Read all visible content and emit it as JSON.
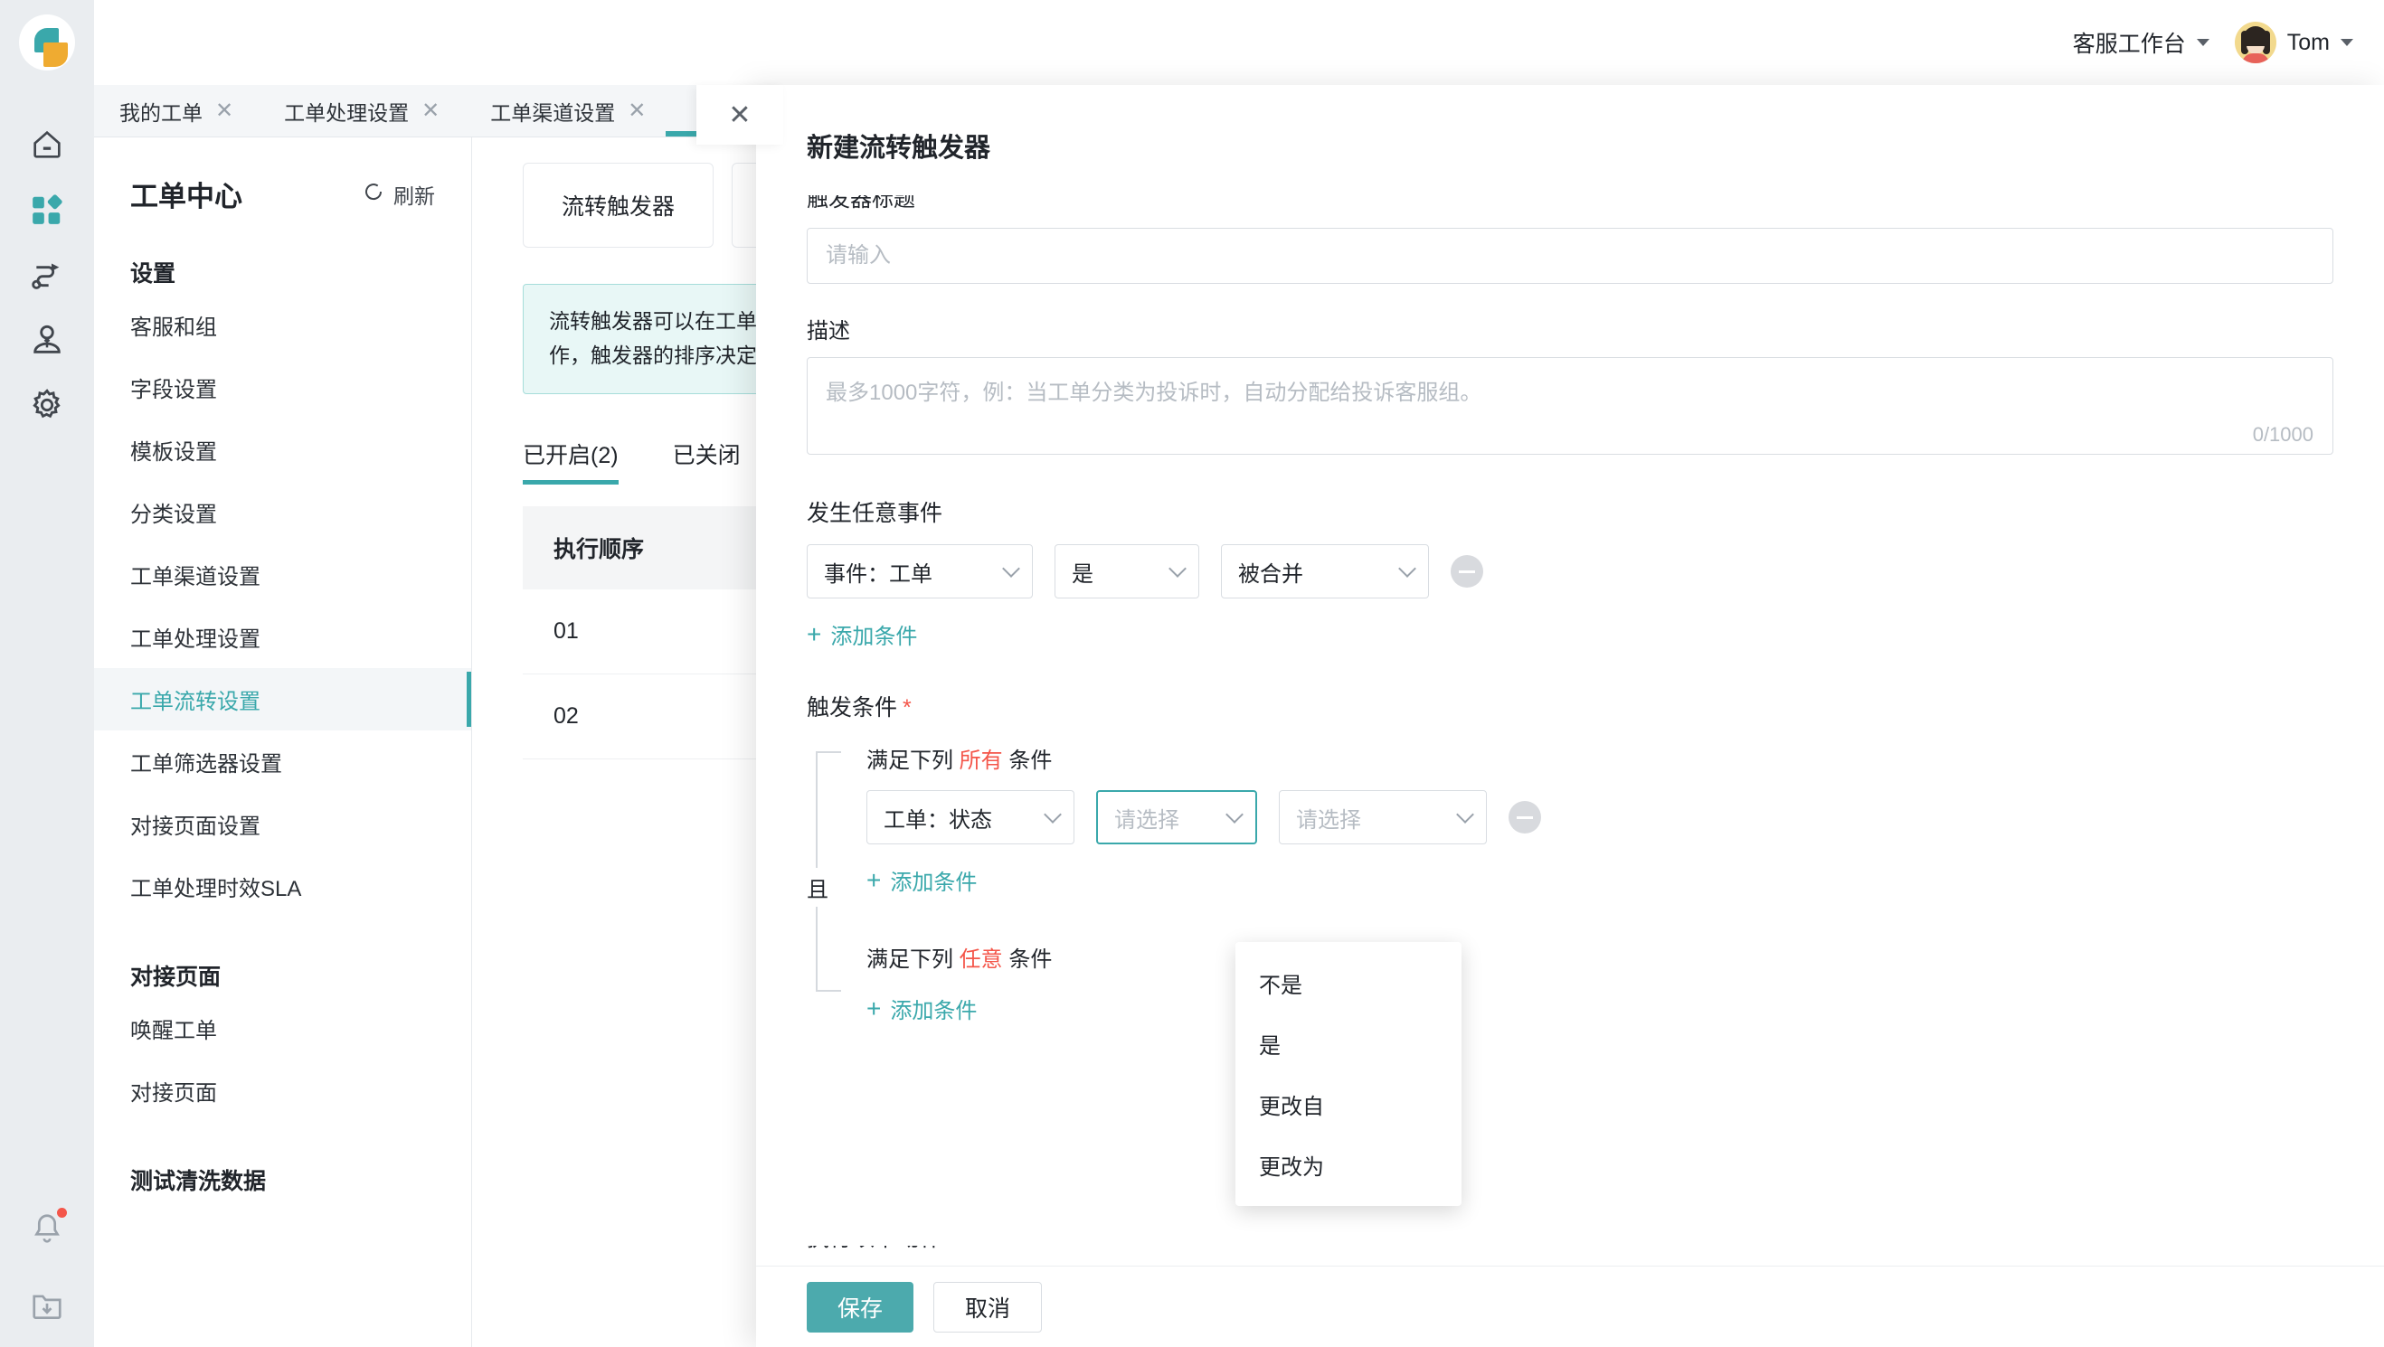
{
  "header": {
    "workspace": "客服工作台",
    "username": "Tom"
  },
  "tabs": [
    {
      "label": "我的工单",
      "close": "✕"
    },
    {
      "label": "工单处理设置",
      "close": "✕"
    },
    {
      "label": "工单渠道设置",
      "close": "✕"
    }
  ],
  "drawer_tab_close": "✕",
  "sidebar": {
    "title": "工单中心",
    "refresh": "刷新",
    "groups": [
      {
        "title": "设置",
        "items": [
          {
            "label": "客服和组",
            "active": false
          },
          {
            "label": "字段设置",
            "active": false
          },
          {
            "label": "模板设置",
            "active": false
          },
          {
            "label": "分类设置",
            "active": false
          },
          {
            "label": "工单渠道设置",
            "active": false
          },
          {
            "label": "工单处理设置",
            "active": false
          },
          {
            "label": "工单流转设置",
            "active": true
          },
          {
            "label": "工单筛选器设置",
            "active": false
          },
          {
            "label": "对接页面设置",
            "active": false
          },
          {
            "label": "工单处理时效SLA",
            "active": false
          }
        ]
      },
      {
        "title": "对接页面",
        "items": [
          {
            "label": "唤醒工单",
            "active": false
          },
          {
            "label": "对接页面",
            "active": false
          }
        ]
      },
      {
        "title": "测试清洗数据",
        "items": []
      }
    ]
  },
  "content": {
    "card_tabs": [
      "流转触发器"
    ],
    "notice": "流转触发器可以在工单创建或更新时自动执行一系列动作，触发器的排序决定了执行的先后顺序。",
    "sub_tabs": [
      {
        "label": "已开启(2)",
        "selected": true
      },
      {
        "label": "已关闭",
        "selected": false
      }
    ],
    "table": {
      "header": "执行顺序",
      "rows": [
        "01",
        "02"
      ]
    }
  },
  "modal": {
    "title": "新建流转触发器",
    "name_field": {
      "label": "触发器标题",
      "placeholder": "请输入",
      "value": ""
    },
    "desc_field": {
      "label": "描述",
      "placeholder": "最多1000字符，例：当工单分类为投诉时，自动分配给投诉客服组。",
      "value": "",
      "counter": "0/1000"
    },
    "event_section": {
      "label": "发生任意事件",
      "selects": [
        {
          "value": "事件：工单",
          "placeholder": ""
        },
        {
          "value": "是",
          "placeholder": ""
        },
        {
          "value": "被合并",
          "placeholder": ""
        }
      ],
      "remove_label": "−",
      "add_label": "添加条件",
      "add_plus": "+"
    },
    "trigger_section": {
      "label": "触发条件",
      "required_mark": "*",
      "and_joiner": "且",
      "group_all": {
        "prefix": "满足下列",
        "keyword": "所有",
        "suffix": "条件",
        "selects": [
          {
            "value": "工单：状态",
            "placeholder": "",
            "focused": false
          },
          {
            "value": "",
            "placeholder": "请选择",
            "focused": true
          },
          {
            "value": "",
            "placeholder": "请选择",
            "focused": false
          }
        ],
        "remove_label": "−",
        "add_label": "添加条件",
        "add_plus": "+"
      },
      "group_any": {
        "prefix": "满足下列",
        "keyword": "任意",
        "suffix": "条件",
        "add_label": "添加条件",
        "add_plus": "+"
      }
    },
    "dropdown": {
      "options": [
        "不是",
        "是",
        "更改自",
        "更改为"
      ]
    },
    "action_section": {
      "label": "执行以下动作",
      "required_mark": "*"
    },
    "footer": {
      "save": "保存",
      "cancel": "取消"
    }
  },
  "colors": {
    "accent": "#3aa8ab",
    "accent_btn": "#4caaad",
    "danger": "#f4564a",
    "rail_bg": "#eaedf0",
    "notice_bg": "#e8f7f6"
  }
}
